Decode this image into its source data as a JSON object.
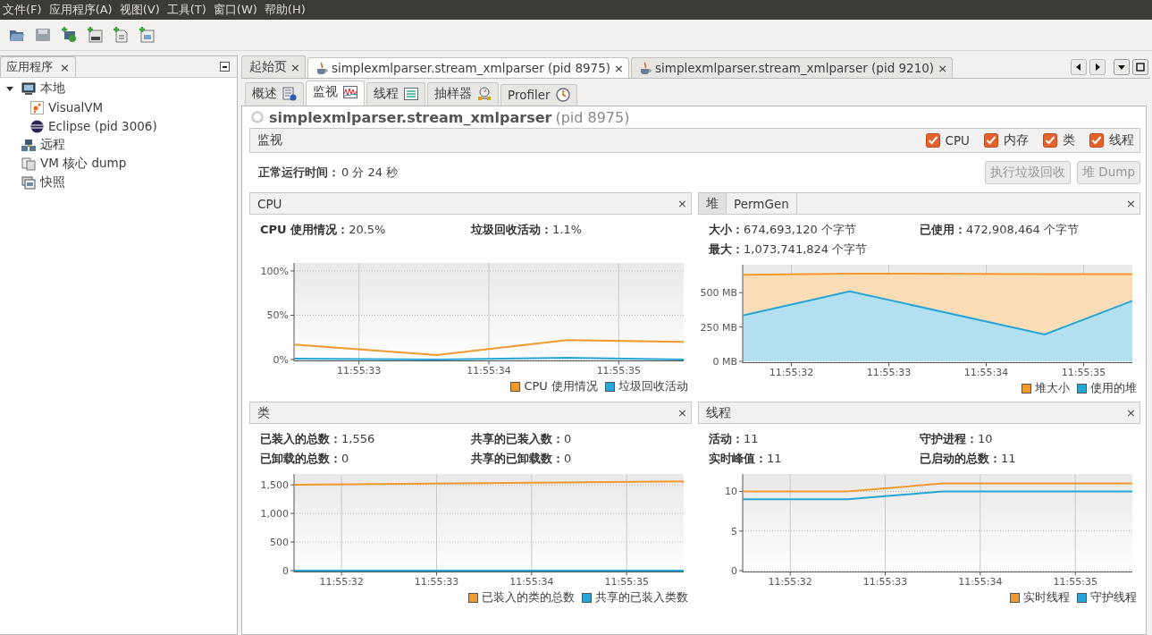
{
  "menu": [
    "文件(F)",
    "应用程序(A)",
    "视图(V)",
    "工具(T)",
    "窗口(W)",
    "帮助(H)"
  ],
  "sidebar": {
    "tab": {
      "label": "应用程序",
      "close": "×"
    },
    "tree": [
      {
        "label": "本地",
        "kind": "host",
        "expanded": true,
        "children": [
          {
            "label": "VisualVM",
            "kind": "visualvm"
          },
          {
            "label": "Eclipse (pid 3006)",
            "kind": "eclipse"
          }
        ]
      },
      {
        "label": "远程",
        "kind": "remote"
      },
      {
        "label": "VM 核心 dump",
        "kind": "dump"
      },
      {
        "label": "快照",
        "kind": "snapshot"
      }
    ]
  },
  "doc_tabs": [
    {
      "label": "起始页",
      "kind": "page",
      "selected": false,
      "close": "×"
    },
    {
      "label": "simplexmlparser.stream_xmlparser (pid 8975)",
      "kind": "process",
      "selected": true,
      "close": "×"
    },
    {
      "label": "simplexmlparser.stream_xmlparser (pid 9210)",
      "kind": "process",
      "selected": false,
      "close": "×"
    }
  ],
  "view_tabs": [
    {
      "label": "概述",
      "kind": "overview",
      "selected": false
    },
    {
      "label": "监视",
      "kind": "monitor",
      "selected": true
    },
    {
      "label": "线程",
      "kind": "threads",
      "selected": false
    },
    {
      "label": "抽样器",
      "kind": "sampler",
      "selected": false
    },
    {
      "label": "Profiler",
      "kind": "profiler",
      "selected": false
    }
  ],
  "title": {
    "name": "simplexmlparser.stream_xmlparser",
    "pid": "(pid 8975)"
  },
  "monitor_bar": {
    "label": "监视",
    "toggles": [
      {
        "label": "CPU",
        "checked": true
      },
      {
        "label": "内存",
        "checked": true
      },
      {
        "label": "类",
        "checked": true
      },
      {
        "label": "线程",
        "checked": true
      }
    ]
  },
  "uptime": {
    "label": "正常运行时间：",
    "value": "0 分 24 秒"
  },
  "buttons": [
    {
      "label": "执行垃圾回收",
      "disabled": true
    },
    {
      "label": "堆 Dump",
      "disabled": true
    }
  ],
  "panels": [
    {
      "title": "CPU",
      "close": "×",
      "stats": [
        {
          "label": "CPU 使用情况：",
          "value": "20.5%"
        },
        {
          "label": "垃圾回收活动：",
          "value": "1.1%"
        }
      ],
      "chart_data": {
        "type": "line",
        "grid": true,
        "x": [
          42932.5,
          42933.6,
          42934.6,
          42935.5
        ],
        "xlim": [
          42932.5,
          42935.5
        ],
        "ylim": [
          0,
          109
        ],
        "xticks": [
          {
            "value": 42933,
            "label": "11:55:33"
          },
          {
            "value": 42934,
            "label": "11:55:34"
          },
          {
            "value": 42935,
            "label": "11:55:35"
          }
        ],
        "yticks": [
          {
            "value": 0,
            "label": "0%"
          },
          {
            "value": 50,
            "label": "50%"
          },
          {
            "value": 100,
            "label": "100%"
          }
        ],
        "series": [
          {
            "name": "CPU 使用情况",
            "color": "#f09a2e",
            "values": [
              17,
              5,
              22,
              20
            ]
          },
          {
            "name": "垃圾回收活动",
            "color": "#26a5d6",
            "values": [
              1,
              0,
              2,
              0
            ]
          }
        ]
      }
    },
    {
      "tabs": [
        {
          "label": "堆",
          "selected": true
        },
        {
          "label": "PermGen",
          "selected": false
        }
      ],
      "close": "×",
      "stats": [
        {
          "label": "大小：",
          "value": "674,693,120 个字节"
        },
        {
          "label": "已使用：",
          "value": "472,908,464 个字节"
        },
        {
          "label": "最大：",
          "value": "1,073,741,824 个字节"
        }
      ],
      "chart_data": {
        "type": "area",
        "grid": true,
        "x": [
          42931.5,
          42932.6,
          42934.6,
          42935.5
        ],
        "xlim": [
          42931.5,
          42935.5
        ],
        "ylim": [
          0,
          703
        ],
        "xticks": [
          {
            "value": 42932,
            "label": "11:55:32"
          },
          {
            "value": 42933,
            "label": "11:55:33"
          },
          {
            "value": 42934,
            "label": "11:55:34"
          },
          {
            "value": 42935,
            "label": "11:55:35"
          }
        ],
        "yticks": [
          {
            "value": 0,
            "label": "0 MB"
          },
          {
            "value": 250,
            "label": "250 MB"
          },
          {
            "value": 500,
            "label": "500 MB"
          }
        ],
        "series": [
          {
            "name": "堆大小",
            "color": "#f09a2e",
            "values": [
              630,
              638,
              635,
              635
            ]
          },
          {
            "name": "使用的堆",
            "color": "#26a5d6",
            "values": [
              333,
              510,
              195,
              440
            ]
          }
        ]
      }
    },
    {
      "title": "类",
      "close": "×",
      "stats": [
        {
          "label": "已装入的总数：",
          "value": "1,556"
        },
        {
          "label": "共享的已装入数：",
          "value": "0"
        },
        {
          "label": "已卸载的总数：",
          "value": "0"
        },
        {
          "label": "共享的已卸载数：",
          "value": "0"
        }
      ],
      "chart_data": {
        "type": "line",
        "grid": true,
        "x": [
          42931.5,
          42935.6
        ],
        "xlim": [
          42931.5,
          42935.6
        ],
        "ylim": [
          0,
          1690
        ],
        "xticks": [
          {
            "value": 42932,
            "label": "11:55:32"
          },
          {
            "value": 42933,
            "label": "11:55:33"
          },
          {
            "value": 42934,
            "label": "11:55:34"
          },
          {
            "value": 42935,
            "label": "11:55:35"
          }
        ],
        "yticks": [
          {
            "value": 0,
            "label": "0"
          },
          {
            "value": 500,
            "label": "500"
          },
          {
            "value": 1000,
            "label": "1,000"
          },
          {
            "value": 1500,
            "label": "1,500"
          }
        ],
        "series": [
          {
            "name": "已装入的类的总数",
            "color": "#f09a2e",
            "values": [
              1500,
              1560
            ]
          },
          {
            "name": "共享的已装入类数",
            "color": "#26a5d6",
            "values": [
              0,
              0
            ]
          }
        ]
      }
    },
    {
      "title": "线程",
      "close": "×",
      "stats": [
        {
          "label": "活动：",
          "value": "11"
        },
        {
          "label": "守护进程：",
          "value": "10"
        },
        {
          "label": "实时峰值：",
          "value": "11"
        },
        {
          "label": "已启动的总数：",
          "value": "11"
        }
      ],
      "chart_data": {
        "type": "line",
        "grid": true,
        "x": [
          42931.5,
          42932.6,
          42933.6,
          42935.6
        ],
        "xlim": [
          42931.5,
          42935.6
        ],
        "ylim": [
          0,
          12.2
        ],
        "xticks": [
          {
            "value": 42932,
            "label": "11:55:32"
          },
          {
            "value": 42933,
            "label": "11:55:33"
          },
          {
            "value": 42934,
            "label": "11:55:34"
          },
          {
            "value": 42935,
            "label": "11:55:35"
          }
        ],
        "yticks": [
          {
            "value": 0,
            "label": "0"
          },
          {
            "value": 5,
            "label": "5"
          },
          {
            "value": 10,
            "label": "10"
          }
        ],
        "series": [
          {
            "name": "实时线程",
            "color": "#f09a2e",
            "values": [
              10,
              10,
              11,
              11
            ]
          },
          {
            "name": "守护线程",
            "color": "#26a5d6",
            "values": [
              9,
              9,
              10,
              10
            ]
          }
        ]
      }
    }
  ]
}
